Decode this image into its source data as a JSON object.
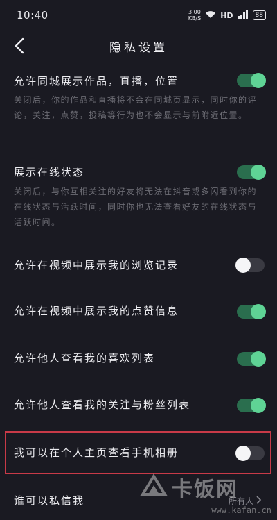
{
  "status": {
    "time": "10:40",
    "net_speed_value": "3.00",
    "net_speed_unit": "KB/S",
    "network": "HD",
    "battery": "88"
  },
  "nav": {
    "title": "隐私设置"
  },
  "settings": [
    {
      "title": "允许同城展示作品，直播，位置",
      "desc": "关闭后，你的作品和直播将不会在同城页显示，同时你的评论，关注，点赞，投稿等行为也不会显示与前附近位置。",
      "enabled": true
    },
    {
      "title": "展示在线状态",
      "desc": "关闭后，与你互相关注的好友将无法在抖音或多闪看到你的在线状态与活跃时间，同时你也无法查看好友的在线状态与活跃时间。",
      "enabled": true
    },
    {
      "title": "允许在视频中展示我的浏览记录",
      "enabled": false
    },
    {
      "title": "允许在视频中展示我的点赞信息",
      "enabled": true
    },
    {
      "title": "允许他人查看我的喜欢列表",
      "enabled": true
    },
    {
      "title": "允许他人查看我的关注与粉丝列表",
      "enabled": true
    },
    {
      "title": "我可以在个人主页查看手机相册",
      "enabled": false
    },
    {
      "title": "谁可以私信我",
      "value": "所有人"
    }
  ],
  "watermark": {
    "brand": "卡饭网",
    "url": "www.kafan.cn"
  }
}
